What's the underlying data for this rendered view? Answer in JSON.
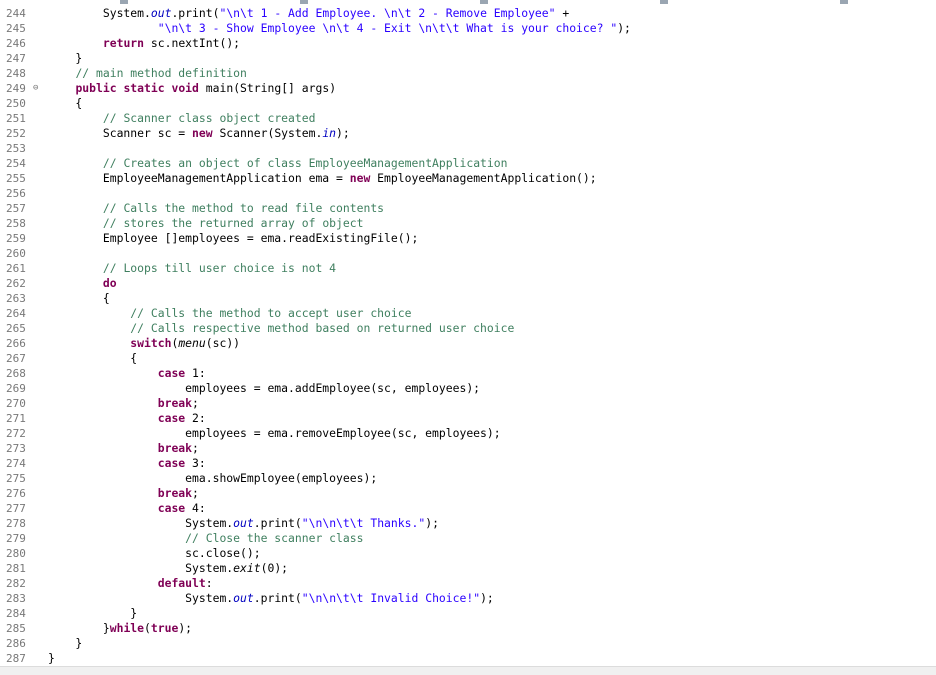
{
  "colors": {
    "keyword": "#7f0055",
    "comment": "#3f7f5f",
    "string": "#2a00ff",
    "field": "#0000c0",
    "line_number": "#787878"
  },
  "editor": {
    "lines": [
      {
        "n": "244",
        "fold": "",
        "tokens": [
          [
            "",
            "        System."
          ],
          [
            "fd",
            "out"
          ],
          [
            "",
            ".print("
          ],
          [
            "st",
            "\"\\n\\t 1 - Add Employee. \\n\\t 2 - Remove Employee\""
          ],
          [
            "",
            " +"
          ]
        ]
      },
      {
        "n": "245",
        "fold": "",
        "tokens": [
          [
            "",
            "                "
          ],
          [
            "st",
            "\"\\n\\t 3 - Show Employee \\n\\t 4 - Exit \\n\\t\\t What is your choice? \""
          ],
          [
            "",
            ");"
          ]
        ]
      },
      {
        "n": "246",
        "fold": "",
        "tokens": [
          [
            "",
            "        "
          ],
          [
            "kw",
            "return"
          ],
          [
            "",
            " sc.nextInt();"
          ]
        ]
      },
      {
        "n": "247",
        "fold": "",
        "tokens": [
          [
            "",
            "    }"
          ]
        ]
      },
      {
        "n": "248",
        "fold": "",
        "tokens": [
          [
            "",
            "    "
          ],
          [
            "cm",
            "// main method definition"
          ]
        ]
      },
      {
        "n": "249",
        "fold": "minus-icon",
        "tokens": [
          [
            "",
            "    "
          ],
          [
            "kw",
            "public"
          ],
          [
            "",
            " "
          ],
          [
            "kw",
            "static"
          ],
          [
            "",
            " "
          ],
          [
            "kw",
            "void"
          ],
          [
            "",
            " main(String[] args)"
          ]
        ]
      },
      {
        "n": "250",
        "fold": "",
        "tokens": [
          [
            "",
            "    {"
          ]
        ]
      },
      {
        "n": "251",
        "fold": "",
        "tokens": [
          [
            "",
            "        "
          ],
          [
            "cm",
            "// Scanner class object created"
          ]
        ]
      },
      {
        "n": "252",
        "fold": "",
        "tokens": [
          [
            "",
            "        Scanner sc = "
          ],
          [
            "kw",
            "new"
          ],
          [
            "",
            " Scanner(System."
          ],
          [
            "fd",
            "in"
          ],
          [
            "",
            ");"
          ]
        ]
      },
      {
        "n": "253",
        "fold": "",
        "tokens": []
      },
      {
        "n": "254",
        "fold": "",
        "tokens": [
          [
            "",
            "        "
          ],
          [
            "cm",
            "// Creates an object of class EmployeeManagementApplication"
          ]
        ]
      },
      {
        "n": "255",
        "fold": "",
        "tokens": [
          [
            "",
            "        EmployeeManagementApplication ema = "
          ],
          [
            "kw",
            "new"
          ],
          [
            "",
            " EmployeeManagementApplication();"
          ]
        ]
      },
      {
        "n": "256",
        "fold": "",
        "tokens": []
      },
      {
        "n": "257",
        "fold": "",
        "tokens": [
          [
            "",
            "        "
          ],
          [
            "cm",
            "// Calls the method to read file contents"
          ]
        ]
      },
      {
        "n": "258",
        "fold": "",
        "tokens": [
          [
            "",
            "        "
          ],
          [
            "cm",
            "// stores the returned array of object"
          ]
        ]
      },
      {
        "n": "259",
        "fold": "",
        "tokens": [
          [
            "",
            "        Employee []employees = ema.readExistingFile();"
          ]
        ]
      },
      {
        "n": "260",
        "fold": "",
        "tokens": []
      },
      {
        "n": "261",
        "fold": "",
        "tokens": [
          [
            "",
            "        "
          ],
          [
            "cm",
            "// Loops till user choice is not 4"
          ]
        ]
      },
      {
        "n": "262",
        "fold": "",
        "tokens": [
          [
            "",
            "        "
          ],
          [
            "kw",
            "do"
          ]
        ]
      },
      {
        "n": "263",
        "fold": "",
        "tokens": [
          [
            "",
            "        {"
          ]
        ]
      },
      {
        "n": "264",
        "fold": "",
        "tokens": [
          [
            "",
            "            "
          ],
          [
            "cm",
            "// Calls the method to accept user choice"
          ]
        ]
      },
      {
        "n": "265",
        "fold": "",
        "tokens": [
          [
            "",
            "            "
          ],
          [
            "cm",
            "// Calls respective method based on returned user choice"
          ]
        ]
      },
      {
        "n": "266",
        "fold": "",
        "tokens": [
          [
            "",
            "            "
          ],
          [
            "kw",
            "switch"
          ],
          [
            "",
            "("
          ],
          [
            "it",
            "menu"
          ],
          [
            "",
            "(sc))"
          ]
        ]
      },
      {
        "n": "267",
        "fold": "",
        "tokens": [
          [
            "",
            "            {"
          ]
        ]
      },
      {
        "n": "268",
        "fold": "",
        "tokens": [
          [
            "",
            "                "
          ],
          [
            "kw",
            "case"
          ],
          [
            "",
            " 1:"
          ]
        ]
      },
      {
        "n": "269",
        "fold": "",
        "tokens": [
          [
            "",
            "                    employees = ema.addEmployee(sc, employees);"
          ]
        ]
      },
      {
        "n": "270",
        "fold": "",
        "tokens": [
          [
            "",
            "                "
          ],
          [
            "kw",
            "break"
          ],
          [
            "",
            ";"
          ]
        ]
      },
      {
        "n": "271",
        "fold": "",
        "tokens": [
          [
            "",
            "                "
          ],
          [
            "kw",
            "case"
          ],
          [
            "",
            " 2:"
          ]
        ]
      },
      {
        "n": "272",
        "fold": "",
        "tokens": [
          [
            "",
            "                    employees = ema.removeEmployee(sc, employees);"
          ]
        ]
      },
      {
        "n": "273",
        "fold": "",
        "tokens": [
          [
            "",
            "                "
          ],
          [
            "kw",
            "break"
          ],
          [
            "",
            ";"
          ]
        ]
      },
      {
        "n": "274",
        "fold": "",
        "tokens": [
          [
            "",
            "                "
          ],
          [
            "kw",
            "case"
          ],
          [
            "",
            " 3:"
          ]
        ]
      },
      {
        "n": "275",
        "fold": "",
        "tokens": [
          [
            "",
            "                    ema.showEmployee(employees);"
          ]
        ]
      },
      {
        "n": "276",
        "fold": "",
        "tokens": [
          [
            "",
            "                "
          ],
          [
            "kw",
            "break"
          ],
          [
            "",
            ";"
          ]
        ]
      },
      {
        "n": "277",
        "fold": "",
        "tokens": [
          [
            "",
            "                "
          ],
          [
            "kw",
            "case"
          ],
          [
            "",
            " 4:"
          ]
        ]
      },
      {
        "n": "278",
        "fold": "",
        "tokens": [
          [
            "",
            "                    System."
          ],
          [
            "fd",
            "out"
          ],
          [
            "",
            ".print("
          ],
          [
            "st",
            "\"\\n\\n\\t\\t Thanks.\""
          ],
          [
            "",
            ");"
          ]
        ]
      },
      {
        "n": "279",
        "fold": "",
        "tokens": [
          [
            "",
            "                    "
          ],
          [
            "cm",
            "// Close the scanner class"
          ]
        ]
      },
      {
        "n": "280",
        "fold": "",
        "tokens": [
          [
            "",
            "                    sc.close();"
          ]
        ]
      },
      {
        "n": "281",
        "fold": "",
        "tokens": [
          [
            "",
            "                    System."
          ],
          [
            "it",
            "exit"
          ],
          [
            "",
            "(0);"
          ]
        ]
      },
      {
        "n": "282",
        "fold": "",
        "tokens": [
          [
            "",
            "                "
          ],
          [
            "kw",
            "default"
          ],
          [
            "",
            ":"
          ]
        ]
      },
      {
        "n": "283",
        "fold": "",
        "tokens": [
          [
            "",
            "                    System."
          ],
          [
            "fd",
            "out"
          ],
          [
            "",
            ".print("
          ],
          [
            "st",
            "\"\\n\\n\\t\\t Invalid Choice!\""
          ],
          [
            "",
            ");"
          ]
        ]
      },
      {
        "n": "284",
        "fold": "",
        "tokens": [
          [
            "",
            "            }"
          ]
        ]
      },
      {
        "n": "285",
        "fold": "",
        "tokens": [
          [
            "",
            "        }"
          ],
          [
            "kw",
            "while"
          ],
          [
            "",
            "("
          ],
          [
            "kw",
            "true"
          ],
          [
            "",
            ");"
          ]
        ]
      },
      {
        "n": "286",
        "fold": "",
        "tokens": [
          [
            "",
            "    }"
          ]
        ]
      },
      {
        "n": "287",
        "fold": "",
        "tokens": [
          [
            "",
            "}"
          ]
        ]
      }
    ]
  }
}
